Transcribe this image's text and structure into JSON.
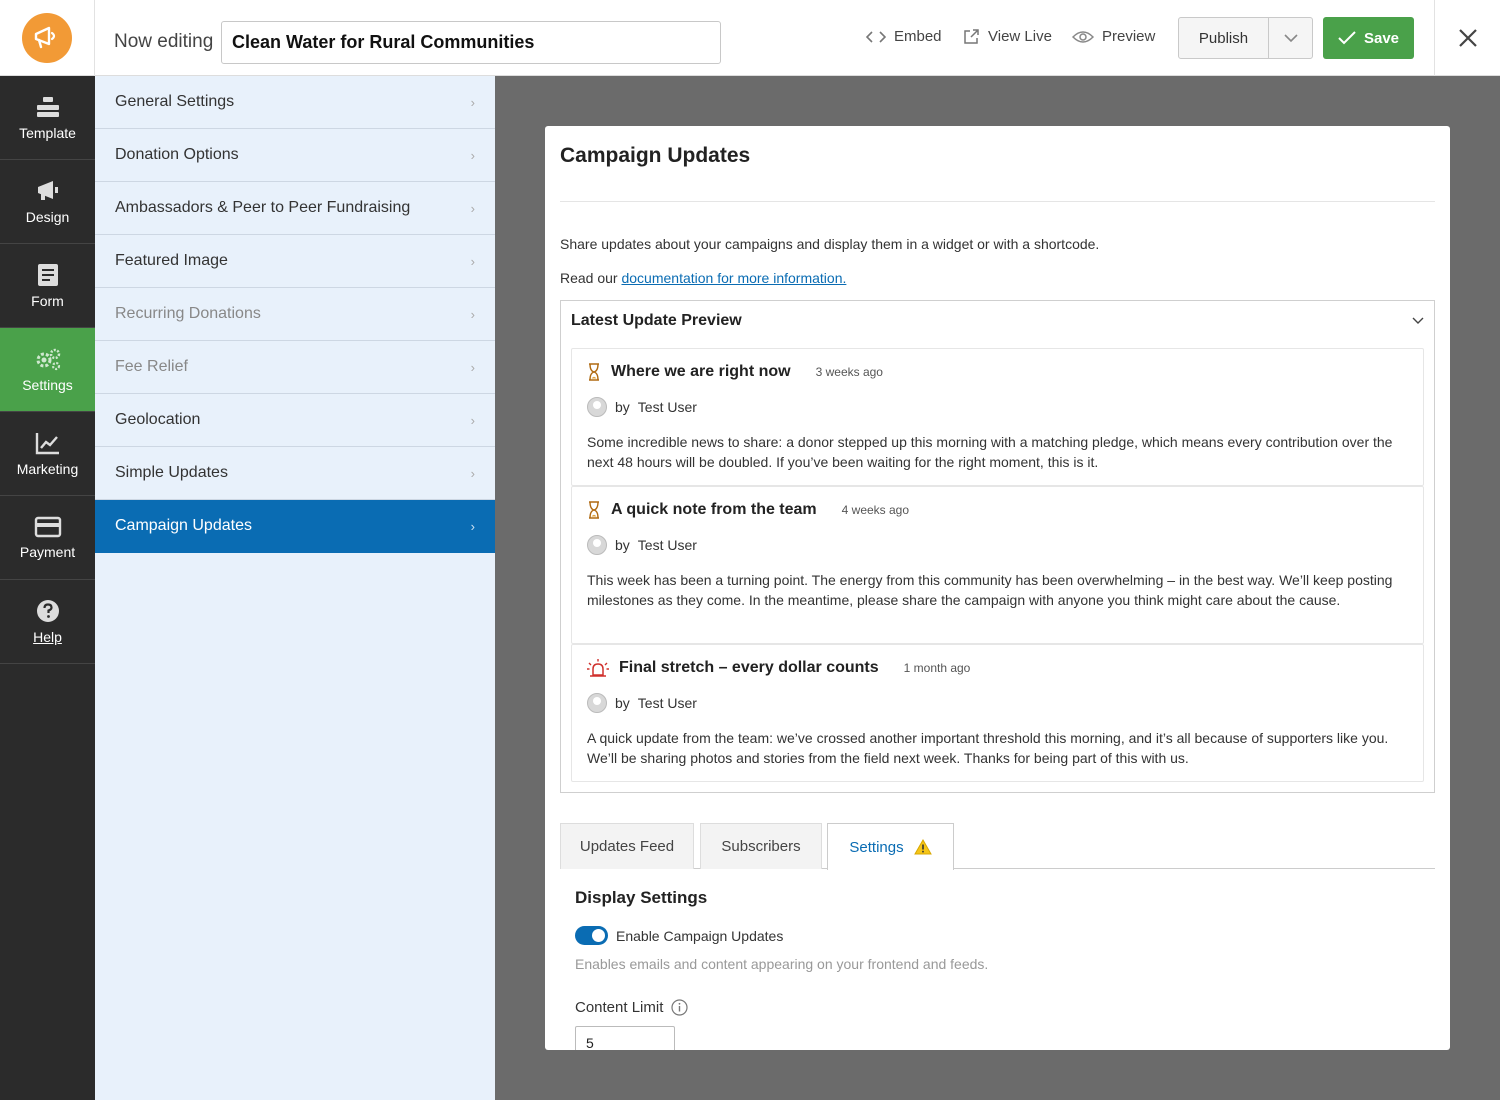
{
  "header": {
    "now_editing_label": "Now editing",
    "campaign_title": "Clean Water for Rural Communities",
    "embed_label": "Embed",
    "view_live_label": "View Live",
    "preview_label": "Preview",
    "publish_label": "Publish",
    "save_label": "Save",
    "accent_color": "#4aa14a",
    "logo_color": "#f29a36"
  },
  "leftnav": {
    "items": [
      {
        "label": "Template",
        "icon": "template-stack-icon"
      },
      {
        "label": "Design",
        "icon": "megaphone-icon"
      },
      {
        "label": "Form",
        "icon": "form-icon"
      },
      {
        "label": "Settings",
        "icon": "gears-icon",
        "active": true
      },
      {
        "label": "Marketing",
        "icon": "chart-line-icon"
      },
      {
        "label": "Payment",
        "icon": "credit-card-icon"
      },
      {
        "label": "Help",
        "icon": "question-circle-icon"
      }
    ]
  },
  "submenu": {
    "items": [
      {
        "label": "General Settings"
      },
      {
        "label": "Donation Options"
      },
      {
        "label": "Ambassadors & Peer to Peer Fundraising"
      },
      {
        "label": "Featured Image"
      },
      {
        "label": "Recurring Donations",
        "disabled": true
      },
      {
        "label": "Fee Relief",
        "disabled": true
      },
      {
        "label": "Geolocation"
      },
      {
        "label": "Simple Updates"
      },
      {
        "label": "Campaign Updates",
        "active": true
      }
    ]
  },
  "card": {
    "title": "Campaign Updates",
    "description": "Share updates about your campaigns and display them in a widget or with a shortcode.",
    "doc_prefix": "Read our",
    "doc_link": "documentation for more information.",
    "preview_title": "Latest Update Preview",
    "updates": [
      {
        "title": "Where we are right now",
        "ago": "3 weeks ago",
        "by": "by",
        "author": "Test User",
        "body": "Some incredible news to share: a donor stepped up this morning with a matching pledge, which means every contribution over the next 48 hours will be doubled. If you’ve been waiting for the right moment, this is it.",
        "icon": "hourglass-icon"
      },
      {
        "title": "A quick note from the team",
        "ago": "4 weeks ago",
        "by": "by",
        "author": "Test User",
        "body": "This week has been a turning point. The energy from this community has been overwhelming – in the best way. We’ll keep posting milestones as they come. In the meantime, please share the campaign with anyone you think might care about the cause.",
        "icon": "hourglass-icon"
      },
      {
        "title": "Final stretch – every dollar counts",
        "ago": "1 month ago",
        "by": "by",
        "author": "Test User",
        "body": "A quick update from the team: we’ve crossed another important threshold this morning, and it’s all because of supporters like you. We’ll be sharing photos and stories from the field next week. Thanks for being part of this with us.",
        "icon": "alarm-icon"
      }
    ],
    "tabs": [
      "Updates Feed",
      "Subscribers",
      "Settings"
    ],
    "active_tab": "Settings",
    "display_settings_title": "Display Settings",
    "enable_label": "Enable Campaign Updates",
    "enable_on": true,
    "enable_help": "Enables emails and content appearing on your frontend and feeds.",
    "content_limit_label": "Content Limit",
    "content_limit_value": "5"
  }
}
